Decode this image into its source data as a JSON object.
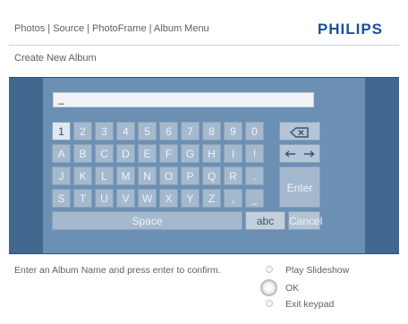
{
  "header": {
    "breadcrumb": "Photos | Source | PhotoFrame | Album Menu",
    "brand": "PHILIPS"
  },
  "subtitle": "Create New Album",
  "input": {
    "value": "_"
  },
  "keyboard": {
    "row1": [
      "1",
      "2",
      "3",
      "4",
      "5",
      "6",
      "7",
      "8",
      "9",
      "0"
    ],
    "row2": [
      "A",
      "B",
      "C",
      "D",
      "E",
      "F",
      "G",
      "H",
      "I",
      "!"
    ],
    "row3": [
      "J",
      "K",
      "L",
      "M",
      "N",
      "O",
      "P",
      "Q",
      "R",
      "."
    ],
    "row4": [
      "S",
      "T",
      "U",
      "V",
      "W",
      "X",
      "Y",
      "Z",
      ",",
      "_"
    ],
    "space_label": "Space",
    "abc_label": "abc",
    "backspace_icon": "backspace-icon",
    "left_arrow_icon": "left-arrow-icon",
    "right_arrow_icon": "right-arrow-icon",
    "enter_label": "Enter",
    "cancel_label": "Cancel",
    "selected_key": "1"
  },
  "footer": {
    "message": "Enter an Album Name and press enter to confirm.",
    "options": [
      {
        "label": "Play Slideshow"
      },
      {
        "label": "OK"
      },
      {
        "label": "Exit keypad"
      }
    ]
  },
  "colors": {
    "panel": "#41688f",
    "band": "#6c90b3",
    "key": "#a4b9ce",
    "selected_key": "#dfe7ef",
    "brand": "#1c4f9c"
  }
}
